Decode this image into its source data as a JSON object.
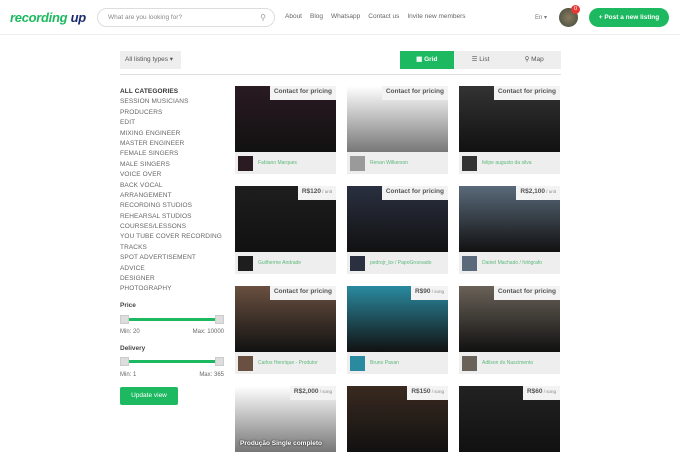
{
  "header": {
    "logo_a": "recording ",
    "logo_b": "up",
    "search_placeholder": "What are you looking for?",
    "nav": [
      "About",
      "Blog",
      "Whatsapp",
      "Contact us",
      "Invite new members"
    ],
    "lang": "En ▾",
    "notifications": "0",
    "post_button": "+ Post a new listing"
  },
  "toolbar": {
    "listing_types": "All listing types ▾",
    "views": [
      {
        "icon": "▦",
        "label": "Grid"
      },
      {
        "icon": "☰",
        "label": "List"
      },
      {
        "icon": "⚲",
        "label": "Map"
      }
    ]
  },
  "sidebar": {
    "categories": [
      "ALL CATEGORIES",
      "SESSION MUSICIANS",
      "PRODUCERS",
      "EDIT",
      "MIXING ENGINEER",
      "MASTER ENGINEER",
      "FEMALE SINGERS",
      "MALE SINGERS",
      "VOICE OVER",
      "BACK VOCAL",
      "ARRANGEMENT",
      "RECORDING STUDIOS",
      "REHEARSAL STUDIOS",
      "COURSES/LESSONS",
      "YOU TUBE COVER RECORDING",
      "TRACKS",
      "SPOT ADVERTISEMENT",
      "ADVICE",
      "DESIGNER",
      "PHOTOGRAPHY"
    ],
    "price": {
      "label": "Price",
      "min": "Min: 20",
      "max": "Max: 10000"
    },
    "delivery": {
      "label": "Delivery",
      "min": "Min: 1",
      "max": "Max: 365"
    },
    "update": "Update view"
  },
  "listings": [
    {
      "title": "Gravação de violino",
      "price": "Contact for pricing",
      "unit": "",
      "author": "Fabiano Marques",
      "bg": "#2a1a22"
    },
    {
      "title": "Gravação de Violinos",
      "price": "Contact for pricing",
      "unit": "",
      "author": "Renan Wilkerson",
      "bg": "#9a9a9a"
    },
    {
      "title": "Vocalista/backing vocal/ compositor",
      "price": "Contact for pricing",
      "unit": "",
      "author": "felipe augusto da silva",
      "bg": "#333"
    },
    {
      "title": "Aulas de Violão e Guitarra",
      "price": "R$120",
      "unit": " / unit",
      "author": "Guilherme Andrade",
      "bg": "#1e1e1e"
    },
    {
      "title": "Gravações Online Contra Baixo - Rec Bass",
      "price": "Contact for pricing",
      "unit": "",
      "author": "pedrojr_bx / PapoGroovado",
      "bg": "#2a3040"
    },
    {
      "title": "Projeto Gráfico (encarte) e Fotografia para Banda",
      "price": "R$2,100",
      "unit": " / unit",
      "author": "Daniel Machado / fotógrafo",
      "bg": "#5a6a7a"
    },
    {
      "title": "Gravação de Violões",
      "price": "Contact for pricing",
      "unit": "",
      "author": "Carlos Henrique - Produtor",
      "bg": "#6a5040"
    },
    {
      "title": "GRAVAÇÕES ONLINE DE GUITARRA",
      "price": "R$90",
      "unit": " / song",
      "author": "Bruno Pavan",
      "bg": "#2a8aa0"
    },
    {
      "title": "Adilson do Nascimento - Back Vocal",
      "price": "Contact for pricing",
      "unit": "",
      "author": "Adilson do Nascimento",
      "bg": "#6a6258"
    },
    {
      "title": "Produção Single completo",
      "price": "R$2,000",
      "unit": " / song",
      "author": "",
      "bg": "#aaa"
    },
    {
      "title": "",
      "price": "R$150",
      "unit": " / song",
      "author": "",
      "bg": "#3a2a20"
    },
    {
      "title": "",
      "price": "R$60",
      "unit": " / song",
      "author": "",
      "bg": "#222"
    }
  ]
}
